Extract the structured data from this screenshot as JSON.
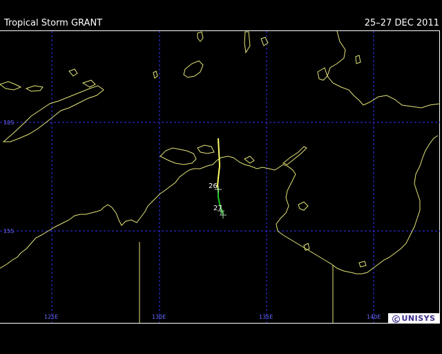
{
  "header": {
    "storm_name": "Tropical Storm GRANT",
    "date_range": "25–27 DEC 2011"
  },
  "map": {
    "region": "Northern Australia / Timor Sea",
    "graticule_color": "#3434ff",
    "coastline_color": "#e6e67a",
    "latitude_labels": [
      "10S",
      "15S"
    ],
    "longitude_labels": [
      "125E",
      "130E",
      "135E",
      "140E"
    ]
  },
  "track": {
    "tropical_storm_color": "#ffff66",
    "tropical_depression_color": "#22cc22",
    "day_labels": [
      "26",
      "27"
    ]
  },
  "logo": {
    "mark": "C",
    "text": "UNISYS"
  }
}
